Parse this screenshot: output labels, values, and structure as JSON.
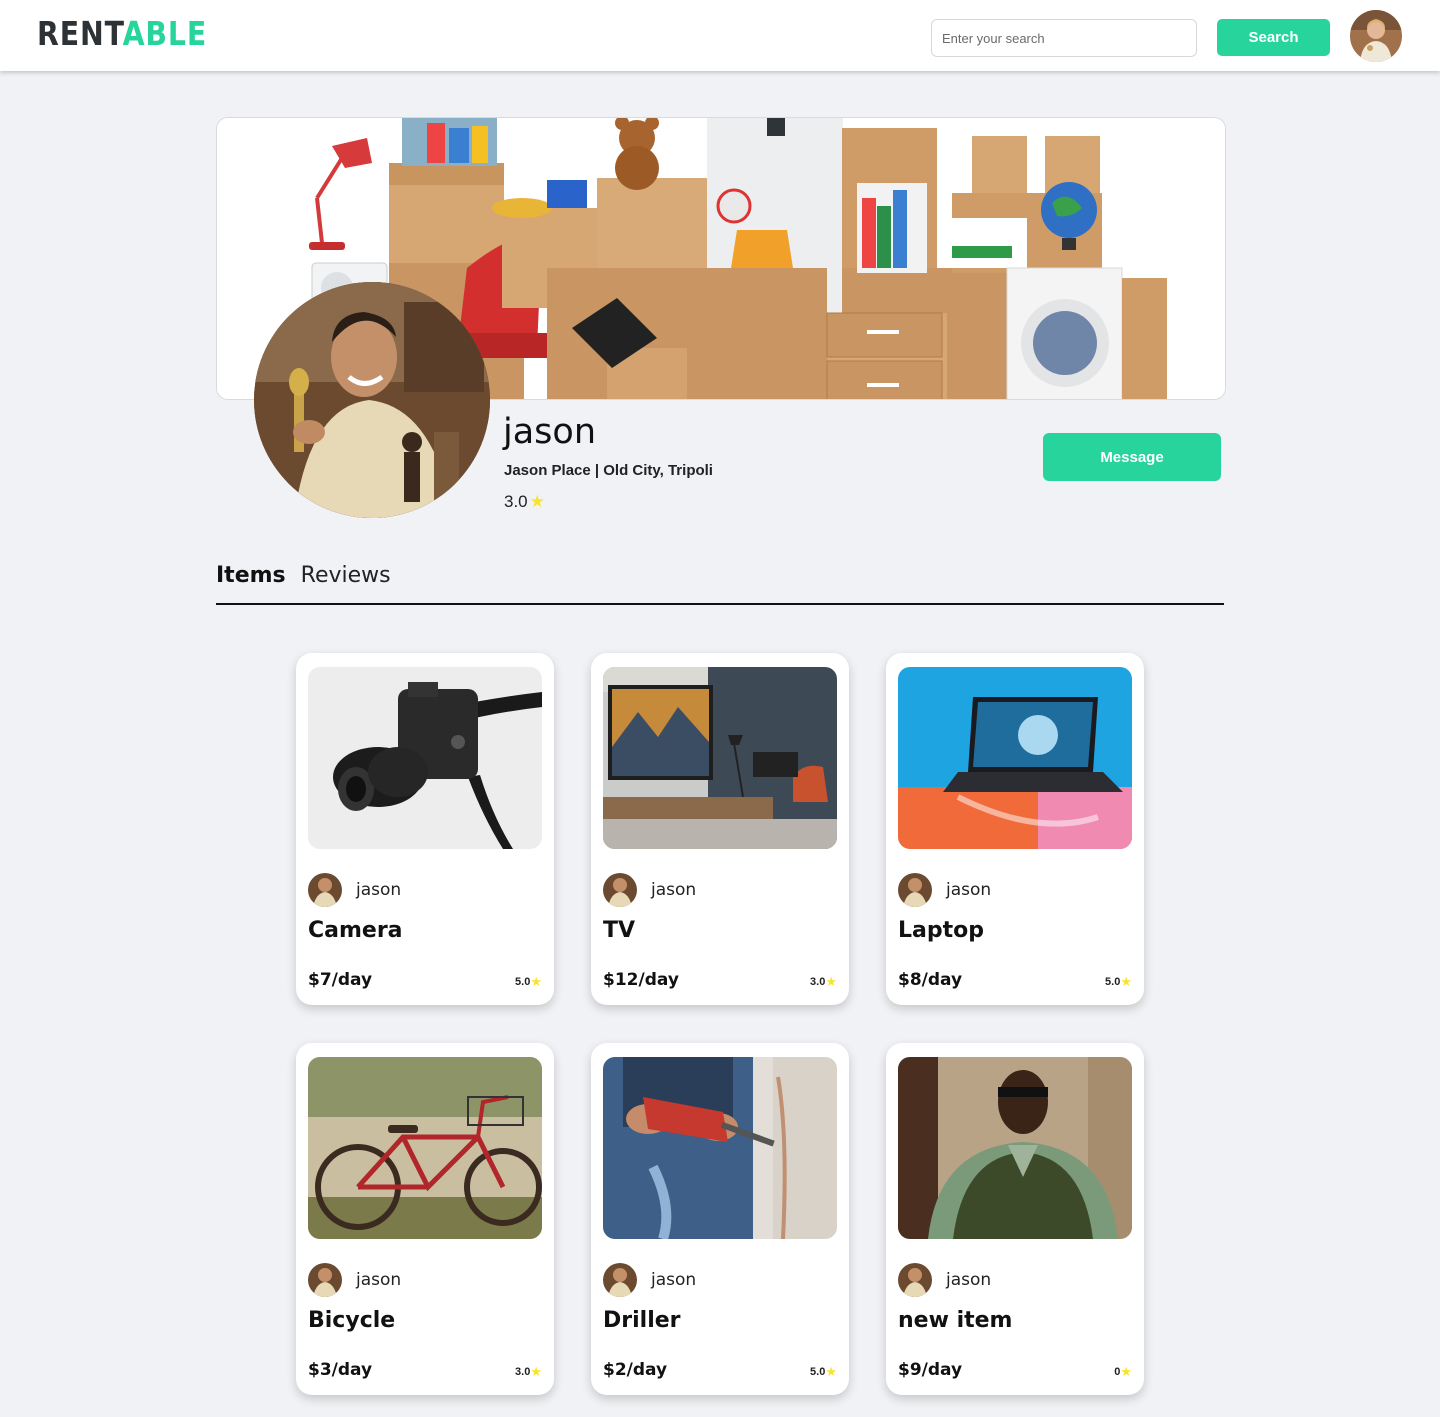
{
  "header": {
    "logo_part1": "RENT",
    "logo_part2": "ABLE",
    "search_placeholder": "Enter your search",
    "search_button": "Search"
  },
  "profile": {
    "name": "jason",
    "location": "Jason Place | Old City, Tripoli",
    "rating": "3.0",
    "message_button": "Message"
  },
  "tabs": [
    {
      "label": "Items",
      "active": true
    },
    {
      "label": "Reviews",
      "active": false
    }
  ],
  "items": [
    {
      "owner": "jason",
      "title": "Camera",
      "price": "$7/day",
      "rating": "5.0",
      "image": "camera-photo"
    },
    {
      "owner": "jason",
      "title": "TV",
      "price": "$12/day",
      "rating": "3.0",
      "image": "tv-photo"
    },
    {
      "owner": "jason",
      "title": "Laptop",
      "price": "$8/day",
      "rating": "5.0",
      "image": "laptop-photo"
    },
    {
      "owner": "jason",
      "title": "Bicycle",
      "price": "$3/day",
      "rating": "3.0",
      "image": "bicycle-photo"
    },
    {
      "owner": "jason",
      "title": "Driller",
      "price": "$2/day",
      "rating": "5.0",
      "image": "driller-photo"
    },
    {
      "owner": "jason",
      "title": "new item",
      "price": "$9/day",
      "rating": "0",
      "image": "person-photo"
    }
  ],
  "colors": {
    "accent": "#27d49c",
    "star": "#f7e52b",
    "background": "#f0f2f5"
  }
}
